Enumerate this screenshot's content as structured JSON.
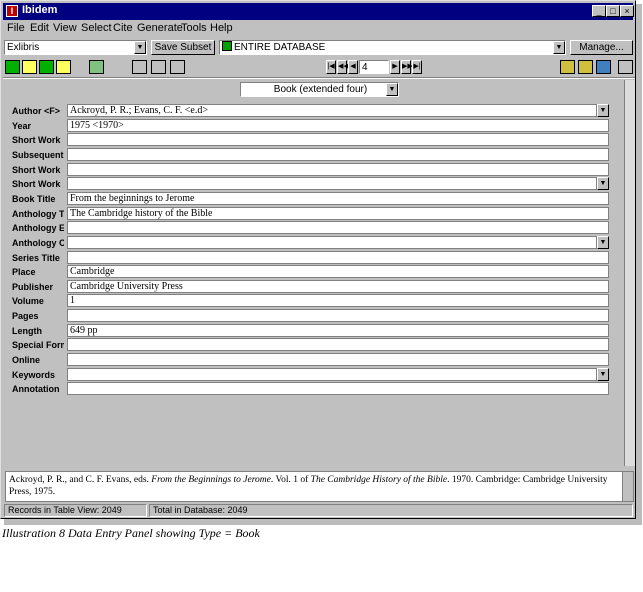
{
  "window": {
    "title": "Ibidem"
  },
  "menu": [
    "File",
    "Edit",
    "View",
    "Select",
    "Cite",
    "Generate",
    "Tools",
    "Help"
  ],
  "toolbar": {
    "subset_select": "Exlibris",
    "save_subset_label": "Save Subset",
    "database_select": "ENTIRE DATABASE",
    "manage_label": "Manage...",
    "record_number": "4"
  },
  "type_select": "Book (extended four)",
  "fields": [
    {
      "label": "Author <F>",
      "value": "Ackroyd, P. R.; Evans, C. F. <e.d>",
      "dropdown": true
    },
    {
      "label": "Year",
      "value": "1975 <1970>",
      "dropdown": false
    },
    {
      "label": "Short Work",
      "value": "",
      "dropdown": false
    },
    {
      "label": "Subsequent",
      "value": "",
      "dropdown": false
    },
    {
      "label": "Short Work",
      "value": "",
      "dropdown": false
    },
    {
      "label": "Short Work",
      "value": "",
      "dropdown": true
    },
    {
      "label": "Book Title",
      "value": "From the beginnings to Jerome",
      "dropdown": false
    },
    {
      "label": "Anthology T",
      "value": "The Cambridge history of the Bible",
      "dropdown": false
    },
    {
      "label": "Anthology E",
      "value": "",
      "dropdown": false
    },
    {
      "label": "Anthology C",
      "value": "",
      "dropdown": true
    },
    {
      "label": "Series Title",
      "value": "",
      "dropdown": false
    },
    {
      "label": "Place",
      "value": "Cambridge",
      "dropdown": false
    },
    {
      "label": "Publisher",
      "value": "Cambridge University Press",
      "dropdown": false
    },
    {
      "label": "Volume",
      "value": "1",
      "dropdown": false
    },
    {
      "label": "Pages",
      "value": "",
      "dropdown": false
    },
    {
      "label": "Length",
      "value": "649 pp",
      "dropdown": false
    },
    {
      "label": "Special Form",
      "value": "",
      "dropdown": false
    },
    {
      "label": "Online",
      "value": "",
      "dropdown": false
    },
    {
      "label": "Keywords",
      "value": "",
      "dropdown": true
    },
    {
      "label": "Annotation",
      "value": "",
      "dropdown": false
    }
  ],
  "citation": {
    "part1": "Ackroyd, P. R., and C. F. Evans, eds. ",
    "title1": "From the Beginnings to Jerome",
    "part2": ". Vol. 1 of ",
    "title2": "The Cambridge History of the Bible",
    "part3": ". 1970. Cambridge: Cambridge University Press, 1975."
  },
  "status": {
    "records_in_view": "Records in Table View: 2049",
    "total_in_database": "Total in Database: 2049"
  },
  "caption": "Illustration 8 Data Entry Panel showing Type = Book"
}
